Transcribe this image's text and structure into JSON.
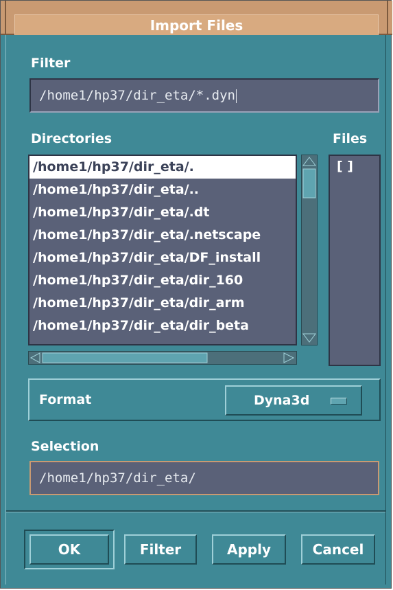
{
  "window": {
    "title": "Import Files"
  },
  "filter": {
    "label": "Filter",
    "value": "/home1/hp37/dir_eta/*.dyn"
  },
  "directories": {
    "label": "Directories",
    "items": [
      "/home1/hp37/dir_eta/.",
      "/home1/hp37/dir_eta/..",
      "/home1/hp37/dir_eta/.dt",
      "/home1/hp37/dir_eta/.netscape",
      "/home1/hp37/dir_eta/DF_install",
      "/home1/hp37/dir_eta/dir_160",
      "/home1/hp37/dir_eta/dir_arm",
      "/home1/hp37/dir_eta/dir_beta"
    ],
    "selected_index": 0
  },
  "files": {
    "label": "Files",
    "items": [
      "[ ]"
    ]
  },
  "format": {
    "label": "Format",
    "selected": "Dyna3d"
  },
  "selection": {
    "label": "Selection",
    "value": "/home1/hp37/dir_eta/"
  },
  "buttons": {
    "ok": "OK",
    "filter": "Filter",
    "apply": "Apply",
    "cancel": "Cancel"
  }
}
